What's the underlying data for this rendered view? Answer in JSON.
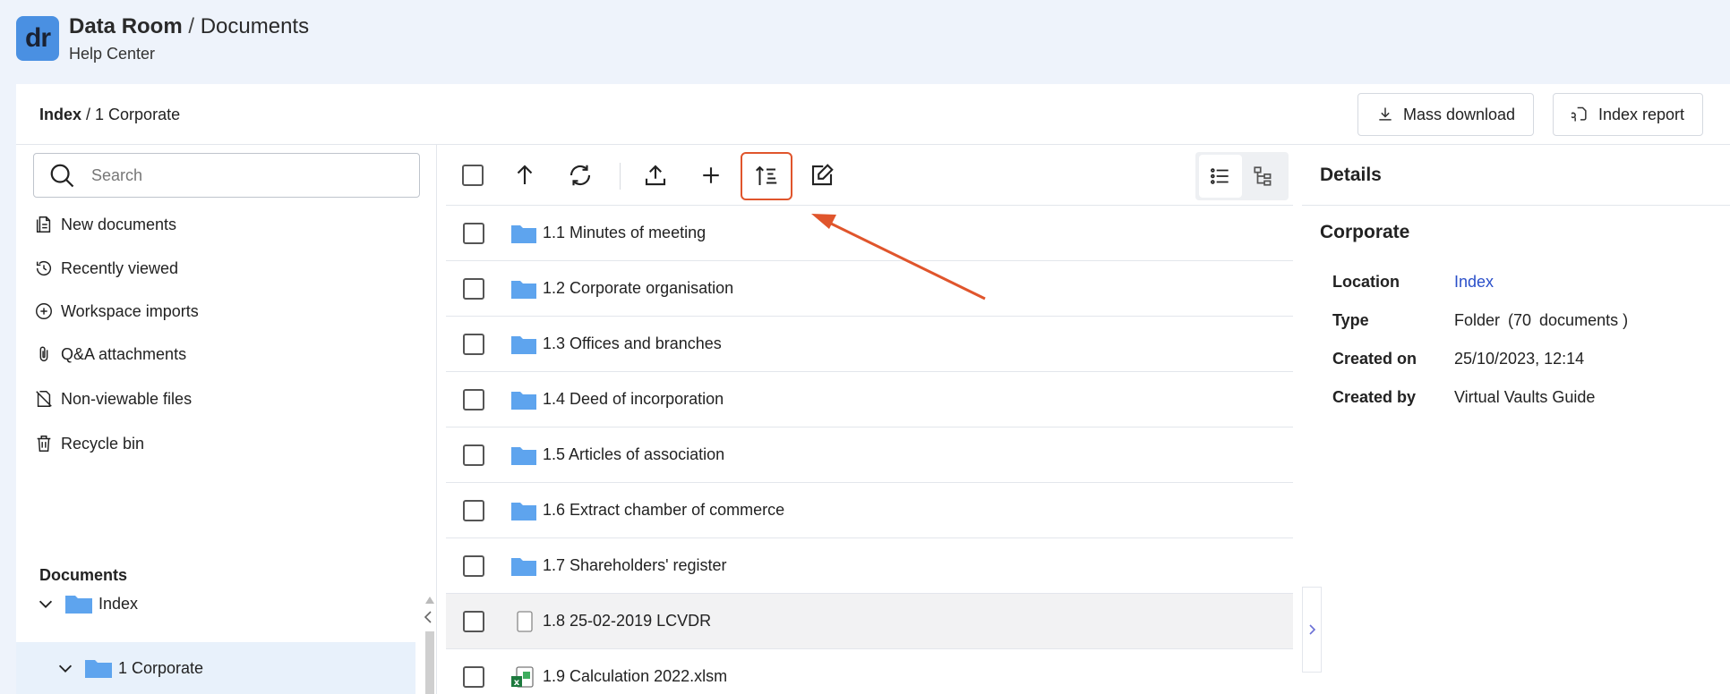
{
  "header": {
    "logo_text": "dr",
    "title_main": "Data Room",
    "title_separator": " / ",
    "title_section": "Documents",
    "subtitle": "Help Center"
  },
  "breadcrumb": {
    "root": "Index",
    "separator": " / ",
    "current": "1 Corporate"
  },
  "actions": {
    "mass_download": "Mass download",
    "index_report": "Index report"
  },
  "sidebar": {
    "search_placeholder": "Search",
    "items": [
      {
        "label": "New documents",
        "icon": "new-documents-icon"
      },
      {
        "label": "Recently viewed",
        "icon": "history-icon"
      },
      {
        "label": "Workspace imports",
        "icon": "plus-circle-icon"
      },
      {
        "label": "Q&A attachments",
        "icon": "paperclip-icon"
      },
      {
        "label": "Non-viewable files",
        "icon": "file-off-icon"
      },
      {
        "label": "Recycle bin",
        "icon": "trash-icon"
      }
    ],
    "documents_heading": "Documents",
    "tree": [
      {
        "label": "Index",
        "expanded": true,
        "level": 0
      },
      {
        "label": "1 Corporate",
        "expanded": true,
        "level": 1,
        "selected": true
      }
    ]
  },
  "toolbar": {
    "buttons": [
      "select-all",
      "up",
      "refresh",
      "upload",
      "add",
      "sort-index",
      "edit"
    ],
    "active_button": "sort-index",
    "view_modes": [
      "list-view",
      "tree-view"
    ],
    "active_view": "list-view"
  },
  "files": [
    {
      "name": "1.1 Minutes of meeting",
      "type": "folder"
    },
    {
      "name": "1.2 Corporate organisation",
      "type": "folder"
    },
    {
      "name": "1.3 Offices and branches",
      "type": "folder"
    },
    {
      "name": "1.4 Deed of incorporation",
      "type": "folder"
    },
    {
      "name": "1.5 Articles of association",
      "type": "folder"
    },
    {
      "name": "1.6 Extract chamber of commerce",
      "type": "folder"
    },
    {
      "name": "1.7 Shareholders' register",
      "type": "folder"
    },
    {
      "name": "1.8 25-02-2019 LCVDR",
      "type": "file"
    },
    {
      "name": "1.9 Calculation 2022.xlsm",
      "type": "excel"
    }
  ],
  "details": {
    "title": "Details",
    "name": "Corporate",
    "fields": [
      {
        "label": "Location",
        "value": "Index",
        "link": true
      },
      {
        "label": "Type",
        "value": "Folder (70 documents )"
      },
      {
        "label": "Created on",
        "value": "25/10/2023, 12:14"
      },
      {
        "label": "Created by",
        "value": "Virtual Vaults Guide"
      }
    ]
  },
  "colors": {
    "accent": "#4a90e2",
    "highlight_border": "#e0552c",
    "link": "#2a4fc9",
    "selected_row": "#e8f1fb"
  }
}
